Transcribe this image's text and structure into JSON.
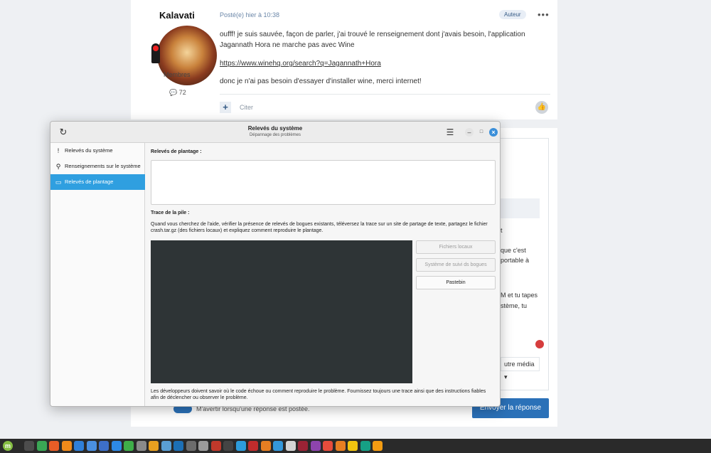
{
  "post": {
    "author": "Kalavati",
    "role": "Membres",
    "count": "72",
    "date": "Posté(e) hier à 10:38",
    "badge": "Auteur",
    "menu": "•••",
    "line1": "oufff! je suis sauvée, façon de parler, j'ai trouvé le renseignement dont j'avais besoin, l'application Jagannath Hora ne marche pas avec Wine",
    "link": "https://www.winehq.org/search?q=Jagannath+Hora",
    "line2": "donc je n'ai pas besoin d'essayer d'installer wine, merci internet!",
    "plus": "+",
    "quote": "Citer"
  },
  "reply": {
    "frag1": "t",
    "frag2": "que c'est",
    "frag3": "portable à",
    "frag4": "M et tu tapes",
    "frag5": "stème, tu",
    "media": "utre média ▾",
    "notify": "M'avertir lorsqu'une réponse est postée.",
    "send": "Envoyer la réponse"
  },
  "window": {
    "title": "Relevés du système",
    "subtitle": "Dépannage des problèmes",
    "sidebar": [
      {
        "label": "Relevés du système",
        "icon": "!"
      },
      {
        "label": "Renseignements sur le système",
        "icon": "⚲"
      },
      {
        "label": "Relevés de plantage",
        "icon": "▭"
      }
    ],
    "crash_label": "Relevés de plantage :",
    "trace_label": "Trace de la pile :",
    "help": "Quand vous cherchez de l'aide, vérifier la présence de relevés de bogues existants, téléversez la trace sur un site de partage de texte, partagez le fichier crash.tar.gz (des fichiers locaux) et expliquez comment reproduire le plantage.",
    "buttons": {
      "local": "Fichiers locaux",
      "tracker": "Système de suivi ds bogues",
      "pastebin": "Pastebin"
    },
    "footer": "Les développeurs doivent savoir où le code échoue ou comment reproduire le problème. Fournissez toujours une trace ainsi que des instructions fiables afin de déclencher ou observer le problème."
  },
  "taskbar": {
    "menu_letter": "m",
    "colors": [
      "#4c4c4c",
      "#3aa655",
      "#e85d26",
      "#f08a1a",
      "#2f7fd8",
      "#4a8fe0",
      "#3d6fc9",
      "#2d8ae6",
      "#3fae49",
      "#8a8a8a",
      "#e8a020",
      "#5a9fd4",
      "#1c6fb5",
      "#6c6c6c",
      "#9b9b9b",
      "#c0392b",
      "#444444",
      "#2d9cdb",
      "#c02c2c",
      "#e67e22",
      "#3498db",
      "#d4d4d4",
      "#9b2335",
      "#8e44ad",
      "#e74c3c",
      "#e67e22",
      "#f1c40f",
      "#16a085",
      "#f39c12"
    ]
  }
}
